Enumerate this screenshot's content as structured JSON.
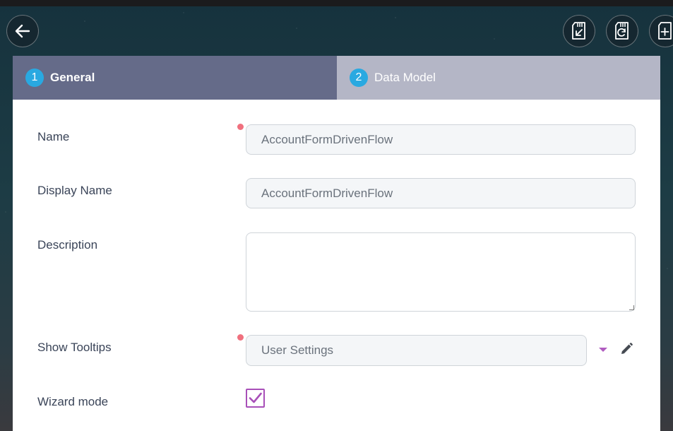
{
  "header": {
    "back_icon": "arrow-left-icon",
    "actions": [
      {
        "name": "import-button",
        "icon": "sd-card-import-icon"
      },
      {
        "name": "refresh-button",
        "icon": "sd-card-refresh-icon"
      },
      {
        "name": "add-button",
        "icon": "sd-card-add-icon"
      }
    ]
  },
  "tabs": [
    {
      "number": "1",
      "label": "General",
      "active": true
    },
    {
      "number": "2",
      "label": "Data Model",
      "active": false
    }
  ],
  "form": {
    "name": {
      "label": "Name",
      "value": "AccountFormDrivenFlow",
      "required": true
    },
    "display_name": {
      "label": "Display Name",
      "value": "AccountFormDrivenFlow",
      "required": false
    },
    "description": {
      "label": "Description",
      "value": ""
    },
    "show_tooltips": {
      "label": "Show Tooltips",
      "value": "User Settings",
      "required": true
    },
    "wizard_mode": {
      "label": "Wizard mode",
      "checked": true
    }
  },
  "colors": {
    "active_tab": "#656b89",
    "inactive_tab": "#b4b6c6",
    "step_badge": "#29a9e1",
    "required_dot": "#f0707e",
    "accent": "#a84fb8"
  }
}
